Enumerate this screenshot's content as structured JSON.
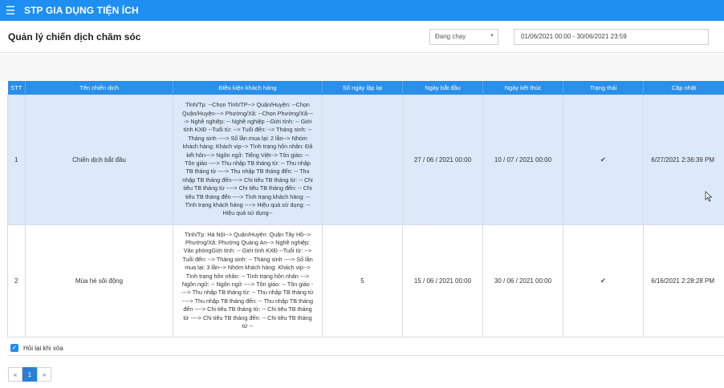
{
  "topbar": {
    "menu_icon": "hamburger-icon",
    "title": "STP GIA DỤNG TIỆN ÍCH"
  },
  "header": {
    "title": "Quản lý chiến dịch chăm sóc",
    "status_select": {
      "value": "Đang chạy"
    },
    "date_range": "01/06/2021 00:00 - 30/06/2021 23:59"
  },
  "table": {
    "columns": [
      "STT",
      "Tên chiến dịch",
      "Điều kiện khách hàng",
      "Số ngày lặp lại",
      "Ngày bắt đầu",
      "Ngày kết thúc",
      "Trạng thái",
      "Cập nhật"
    ],
    "rows": [
      {
        "stt": "1",
        "name": "Chiến dịch bắt đầu",
        "conditions": "Tỉnh/Tp: --Chọn Tỉnh/TP--> Quận/Huyện: --Chọn Quận/Huyện---> Phường/Xã: --Chọn Phường/Xã----> Nghề nghiệp: -- Nghề nghiệp --Giới tính: -- Giới tính KXĐ --Tuổi từ: --> Tuổi đến: --> Tháng sinh: -- Tháng sinh ----> Số lần mua lại: 2 lần--> Nhóm khách hàng: Khách vip--> Tình trạng hôn nhân: Đã kết hôn---> Ngôn ngữ: Tiếng Việt--> Tôn giáo: -- Tôn giáo ----> Thu nhập TB tháng từ: -- Thu nhập TB tháng từ ----> Thu nhập TB tháng đến: -- Thu nhập TB tháng đến----> Chi tiêu TB tháng từ: -- Chi tiêu TB tháng từ ----> Chi tiêu TB tháng đến: -- Chi tiêu TB tháng đến ----> Tình trạng khách hàng: -- Tình trạng khách hàng ----> Hiệu quả sử dụng: -- Hiệu quả sử dụng--",
        "repeat_days": "",
        "start": "27 / 06 / 2021 00:00",
        "end": "10 / 07 / 2021 00:00",
        "status_icon": "check-icon",
        "updated": "6/27/2021 2:36:39 PM"
      },
      {
        "stt": "2",
        "name": "Mùa hè sôi động",
        "conditions": "Tỉnh/Tp: Hà Nội--> Quận/Huyện: Quận Tây Hồ--> Phường/Xã: Phường Quảng An--> Nghề nghiệp: Văn phòngGiới tính: -- Giới tính KXĐ --Tuổi từ: --> Tuổi đến: --> Tháng sinh: -- Tháng sinh ----> Số lần mua lại: 3 lần--> Nhóm khách hàng: Khách vip--> Tình trạng hôn nhân: -- Tình trạng hôn nhân ---> Ngôn ngữ: -- Ngôn ngữ ----> Tôn giáo: -- Tôn giáo ----> Thu nhập TB tháng từ: -- Thu nhập TB tháng từ ----> Thu nhập TB tháng đến: -- Thu nhập TB tháng đến ----> Chi tiêu TB tháng từ: -- Chi tiêu TB tháng từ ----> Chi tiêu TB tháng đến: -- Chi tiêu TB tháng từ --",
        "repeat_days": "5",
        "start": "15 / 06 / 2021 00:00",
        "end": "30 / 06 / 2021 00:00",
        "status_icon": "check-icon",
        "updated": "6/16/2021 2:28:28 PM"
      }
    ]
  },
  "footer": {
    "undo_label": "Hỏi lại khi xóa",
    "pager": {
      "prev": "«",
      "current": "1",
      "next": "»"
    }
  }
}
